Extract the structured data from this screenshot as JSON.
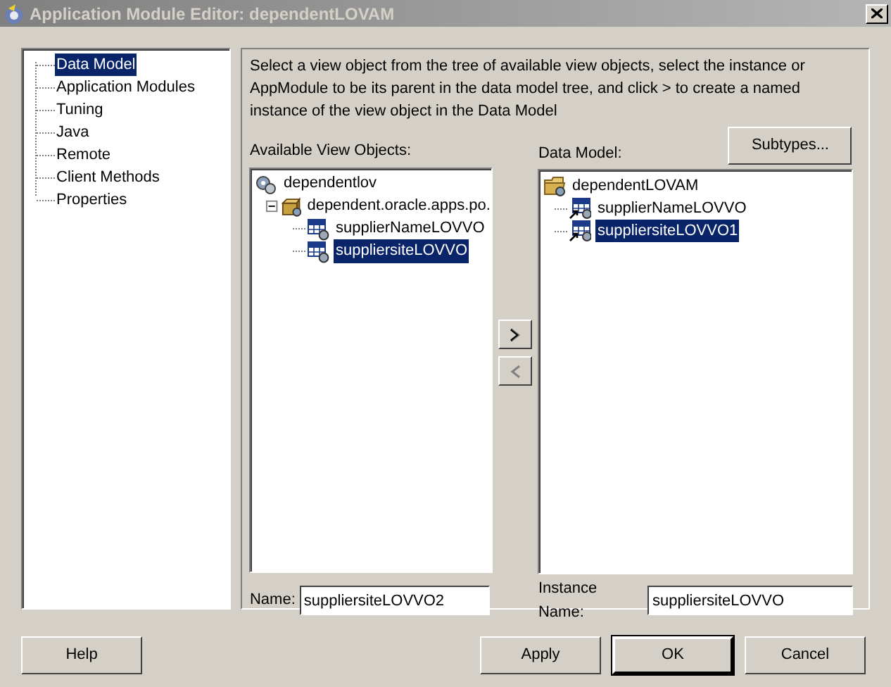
{
  "window": {
    "title": "Application Module Editor: dependentLOVAM"
  },
  "nav": [
    {
      "label": "Data Model",
      "selected": true
    },
    {
      "label": "Application Modules",
      "selected": false
    },
    {
      "label": "Tuning",
      "selected": false
    },
    {
      "label": "Java",
      "selected": false
    },
    {
      "label": "Remote",
      "selected": false
    },
    {
      "label": "Client Methods",
      "selected": false
    },
    {
      "label": "Properties",
      "selected": false
    }
  ],
  "description": "Select a view object from the tree of available view objects, select the instance or AppModule to be its parent in the data model tree, and click > to create a named instance of the view object in the Data Model",
  "available": {
    "label": "Available View Objects:",
    "tree": [
      {
        "label": "dependentlov",
        "kind": "gears",
        "selected": false,
        "children": [
          {
            "label": "dependent.oracle.apps.po.",
            "kind": "package",
            "selected": false,
            "expanded": true,
            "children": [
              {
                "label": "supplierNameLOVVO",
                "kind": "sql",
                "selected": false
              },
              {
                "label": "suppliersiteLOVVO",
                "kind": "sql",
                "selected": true
              }
            ]
          }
        ]
      }
    ]
  },
  "data_model": {
    "label": "Data Model:",
    "subtypes_button": "Subtypes...",
    "tree": [
      {
        "label": "dependentLOVAM",
        "kind": "folder",
        "selected": false,
        "children": [
          {
            "label": "supplierNameLOVVO",
            "kind": "sql-link",
            "selected": false
          },
          {
            "label": "suppliersiteLOVVO1",
            "kind": "sql-link",
            "selected": true
          }
        ]
      }
    ]
  },
  "name_field": {
    "label": "Name:",
    "value": "suppliersiteLOVVO2"
  },
  "instance_name_field": {
    "label": "Instance Name:",
    "value": "suppliersiteLOVVO"
  },
  "buttons": {
    "help": "Help",
    "apply": "Apply",
    "ok": "OK",
    "cancel": "Cancel"
  }
}
